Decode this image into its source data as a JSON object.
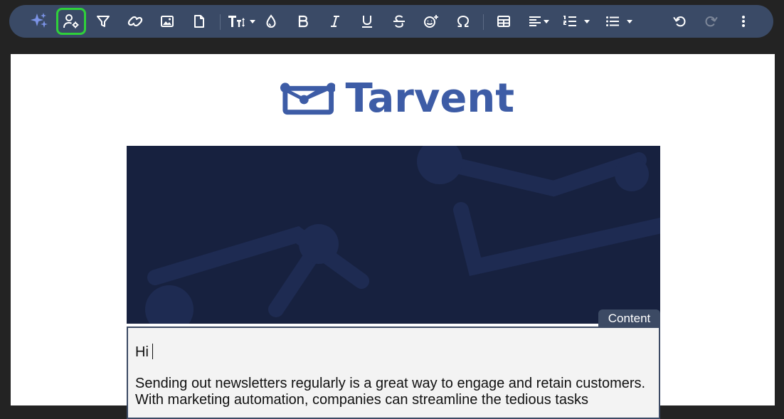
{
  "toolbar": {
    "buttons": [
      {
        "name": "ai-sparkle-button",
        "icon": "sparkle-icon"
      },
      {
        "name": "personalize-button",
        "icon": "user-gear-icon",
        "active": true
      },
      {
        "name": "filter-button",
        "icon": "filter-icon"
      },
      {
        "name": "link-button",
        "icon": "link-icon"
      },
      {
        "name": "image-button",
        "icon": "image-icon"
      },
      {
        "name": "file-button",
        "icon": "file-icon"
      },
      {
        "name": "font-size-button",
        "icon": "text-size-icon"
      },
      {
        "name": "text-color-button",
        "icon": "droplet-icon"
      },
      {
        "name": "bold-button",
        "icon": "bold-icon"
      },
      {
        "name": "italic-button",
        "icon": "italic-icon"
      },
      {
        "name": "underline-button",
        "icon": "underline-icon"
      },
      {
        "name": "strikethrough-button",
        "icon": "strikethrough-icon"
      },
      {
        "name": "emoji-button",
        "icon": "emoji-icon"
      },
      {
        "name": "special-character-button",
        "icon": "omega-icon"
      },
      {
        "name": "table-button",
        "icon": "table-icon"
      },
      {
        "name": "align-button",
        "icon": "align-left-icon"
      },
      {
        "name": "ordered-list-button",
        "icon": "ordered-list-icon"
      },
      {
        "name": "bullet-list-button",
        "icon": "bullet-list-icon"
      },
      {
        "name": "undo-button",
        "icon": "undo-icon"
      },
      {
        "name": "redo-button",
        "icon": "redo-icon",
        "disabled": true
      },
      {
        "name": "more-button",
        "icon": "more-vertical-icon"
      }
    ],
    "active_highlight_color": "#2fd13a"
  },
  "email": {
    "logo_text": "Tarvent",
    "brand_color": "#3d5ca6",
    "banner_color": "#17213f",
    "content_tab_label": "Content",
    "greeting": "Hi",
    "body_line_1": "Sending out newsletters regularly is a great way to engage and retain customers.",
    "body_line_2": "With marketing automation, companies can streamline the tedious tasks"
  }
}
